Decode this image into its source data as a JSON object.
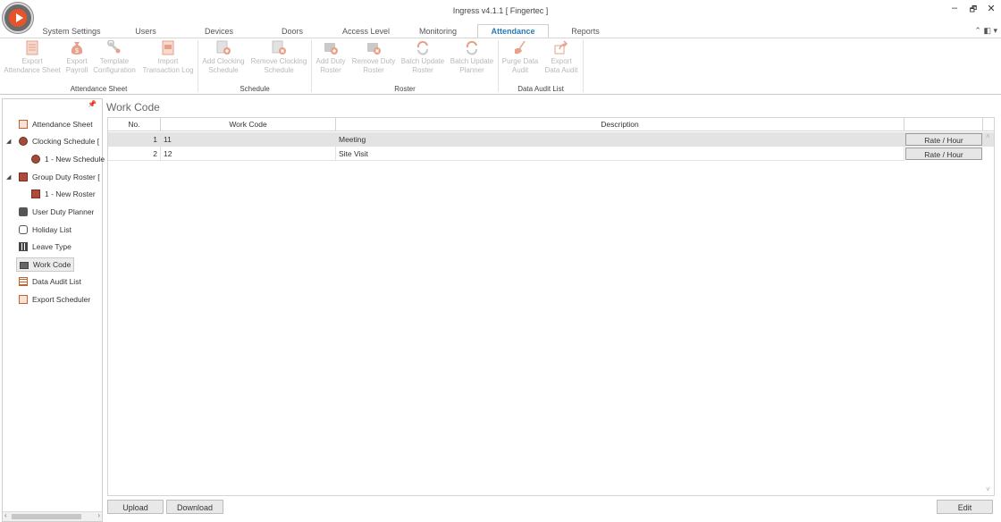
{
  "window": {
    "title": "Ingress v4.1.1 [ Fingertec ]",
    "controls": {
      "minimize": "–",
      "restore": "🗗",
      "close": "✕"
    }
  },
  "menu": {
    "tabs": [
      "System Settings",
      "Users",
      "Devices",
      "Doors",
      "Access Level",
      "Monitoring",
      "Attendance",
      "Reports"
    ],
    "active": "Attendance",
    "right_icons": "⌃ ◧ ▾"
  },
  "ribbon": {
    "groups": [
      {
        "label": "Attendance Sheet",
        "buttons": [
          {
            "line1": "Export",
            "line2": "Attendance Sheet",
            "icon": "sheet-icon"
          },
          {
            "line1": "Export",
            "line2": "Payroll",
            "icon": "money-bag-icon"
          },
          {
            "line1": "Template",
            "line2": "Configuration",
            "icon": "wrench-icon"
          },
          {
            "line1": "Import",
            "line2": "Transaction Log",
            "icon": "log-icon"
          }
        ]
      },
      {
        "label": "Schedule",
        "buttons": [
          {
            "line1": "Add Clocking",
            "line2": "Schedule",
            "icon": "add-schedule-icon"
          },
          {
            "line1": "Remove Clocking",
            "line2": "Schedule",
            "icon": "remove-schedule-icon"
          }
        ]
      },
      {
        "label": "Roster",
        "buttons": [
          {
            "line1": "Add Duty",
            "line2": "Roster",
            "icon": "add-roster-icon"
          },
          {
            "line1": "Remove Duty",
            "line2": "Roster",
            "icon": "remove-roster-icon"
          },
          {
            "line1": "Batch Update",
            "line2": "Roster",
            "icon": "refresh-icon"
          },
          {
            "line1": "Batch Update",
            "line2": "Planner",
            "icon": "refresh-icon"
          }
        ]
      },
      {
        "label": "Data Audit List",
        "buttons": [
          {
            "line1": "Purge Data",
            "line2": "Audit",
            "icon": "broom-icon"
          },
          {
            "line1": "Export",
            "line2": "Data Audit",
            "icon": "export-icon"
          }
        ]
      }
    ]
  },
  "sidebar": {
    "pin": "📌",
    "items": [
      {
        "label": "Attendance Sheet",
        "icon": "sheet-icon"
      },
      {
        "label": "Clocking Schedule [",
        "icon": "clock-icon",
        "expander": "◢"
      },
      {
        "label": "1 - New Schedule",
        "icon": "clock-icon"
      },
      {
        "label": "Group Duty Roster [",
        "icon": "roster-icon",
        "expander": "◢"
      },
      {
        "label": "1 - New Roster",
        "icon": "roster-icon"
      },
      {
        "label": "User Duty Planner",
        "icon": "briefcase-icon"
      },
      {
        "label": "Holiday List",
        "icon": "holiday-icon"
      },
      {
        "label": "Leave Type",
        "icon": "leave-icon"
      },
      {
        "label": "Work Code",
        "icon": "workcode-icon"
      },
      {
        "label": "Data Audit List",
        "icon": "audit-icon"
      },
      {
        "label": "Export Scheduler",
        "icon": "export-scheduler-icon"
      }
    ],
    "selected": "Work Code",
    "scroll_left": "‹",
    "scroll_right": "›"
  },
  "main": {
    "title": "Work Code",
    "columns": {
      "no": "No.",
      "code": "Work Code",
      "desc": "Description",
      "action": ""
    },
    "rows": [
      {
        "no": "1",
        "code": "11",
        "desc": "Meeting",
        "action": "Rate / Hour"
      },
      {
        "no": "2",
        "code": "12",
        "desc": "Site Visit",
        "action": "Rate / Hour"
      }
    ],
    "scroll_up": "˄",
    "scroll_down": "˅",
    "buttons": {
      "upload": "Upload",
      "download": "Download",
      "edit": "Edit"
    }
  },
  "colors": {
    "accent": "#2a7ab5",
    "ribbon_icon": "#e7a08a",
    "logo": "#e8542a"
  }
}
